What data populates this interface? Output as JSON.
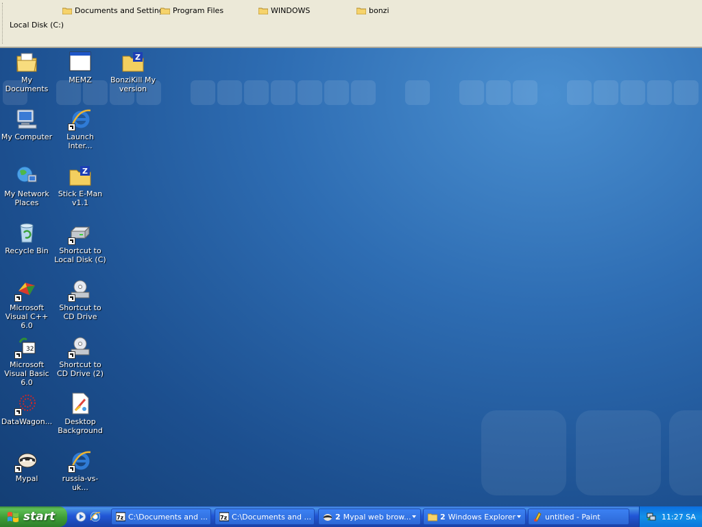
{
  "toolbar": {
    "links": [
      {
        "label": "Documents and Settings"
      },
      {
        "label": "Program Files"
      },
      {
        "label": "WINDOWS"
      },
      {
        "label": "bonzi"
      }
    ],
    "title": "Local Disk (C:)"
  },
  "desktop": {
    "icons": [
      {
        "label": "My Documents"
      },
      {
        "label": "MEMZ"
      },
      {
        "label": "BonziKill My version"
      },
      {
        "label": "My Computer"
      },
      {
        "label": "Launch Inter..."
      },
      {
        "label": "My Network Places"
      },
      {
        "label": "Stick E-Man v1.1"
      },
      {
        "label": "Recycle Bin"
      },
      {
        "label": "Shortcut to Local Disk (C)"
      },
      {
        "label": "Microsoft Visual C++ 6.0"
      },
      {
        "label": "Shortcut to CD Drive"
      },
      {
        "label": "Microsoft Visual Basic 6.0"
      },
      {
        "label": "Shortcut to CD Drive (2)"
      },
      {
        "label": "DataWagon..."
      },
      {
        "label": "Desktop Background"
      },
      {
        "label": "Mypal"
      },
      {
        "label": "russia-vs-uk..."
      }
    ]
  },
  "taskbar": {
    "start_label": "start",
    "tasks": [
      {
        "label": "C:\\Documents and ...",
        "icon": "7zip-icon"
      },
      {
        "label": "C:\\Documents and ...",
        "icon": "7zip-icon"
      },
      {
        "count": "2",
        "label": "Mypal web brow...",
        "icon": "mypal-icon"
      },
      {
        "count": "2",
        "label": "Windows Explorer",
        "icon": "folder-icon"
      },
      {
        "label": "untitled - Paint",
        "icon": "paint-icon"
      }
    ],
    "clock": "11:27 SA"
  },
  "colors": {
    "desktop": "#2e6db3",
    "taskbar": "#245edb",
    "start_button": "#3d9c36"
  }
}
